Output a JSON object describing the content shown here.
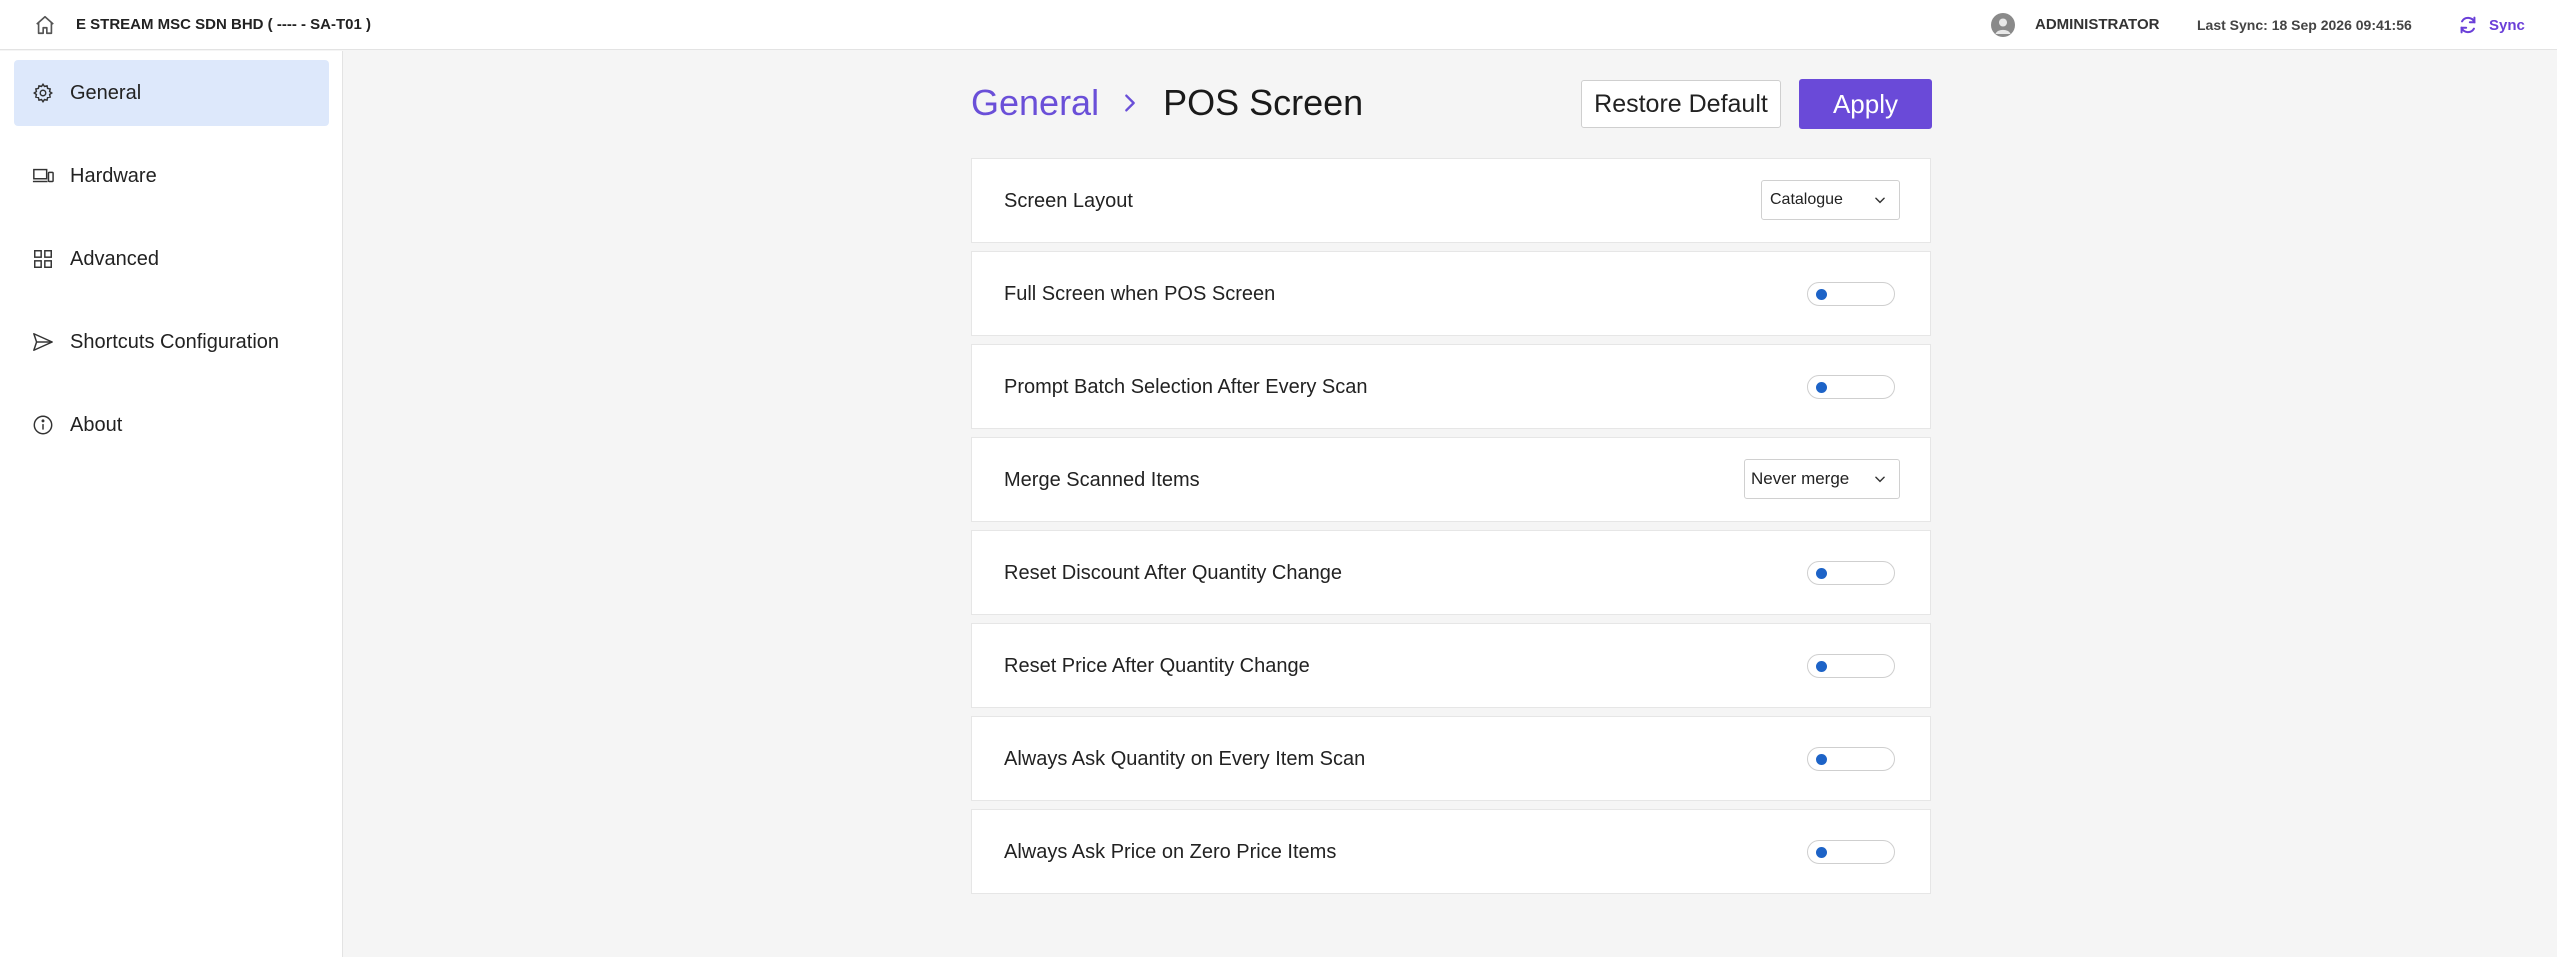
{
  "topbar": {
    "company": "E STREAM MSC SDN BHD ( ---- - SA-T01 )",
    "user": "ADMINISTRATOR",
    "last_sync": "Last Sync: 18 Sep 2026 09:41:56",
    "sync_label": "Sync",
    "accent": "#6a4ad8"
  },
  "sidebar": {
    "items": [
      {
        "label": "General",
        "icon": "gear-icon",
        "active": true
      },
      {
        "label": "Hardware",
        "icon": "devices-icon",
        "active": false
      },
      {
        "label": "Advanced",
        "icon": "grid-icon",
        "active": false
      },
      {
        "label": "Shortcuts Configuration",
        "icon": "send-icon",
        "active": false
      },
      {
        "label": "About",
        "icon": "info-icon",
        "active": false
      }
    ]
  },
  "main": {
    "breadcrumb_parent": "General",
    "breadcrumb_current": "POS Screen",
    "restore_label": "Restore Default",
    "apply_label": "Apply",
    "settings": [
      {
        "label": "Screen Layout",
        "control": "select",
        "value": "Catalogue"
      },
      {
        "label": "Full Screen when POS Screen",
        "control": "toggle",
        "value": false
      },
      {
        "label": "Prompt Batch Selection After Every Scan",
        "control": "toggle",
        "value": false
      },
      {
        "label": "Merge Scanned Items",
        "control": "select",
        "value": "Never merge"
      },
      {
        "label": "Reset Discount After Quantity Change",
        "control": "toggle",
        "value": false
      },
      {
        "label": "Reset Price After Quantity Change",
        "control": "toggle",
        "value": false
      },
      {
        "label": "Always Ask Quantity on Every Item Scan",
        "control": "toggle",
        "value": false
      },
      {
        "label": "Always Ask Price on Zero Price Items",
        "control": "toggle",
        "value": false
      }
    ]
  }
}
